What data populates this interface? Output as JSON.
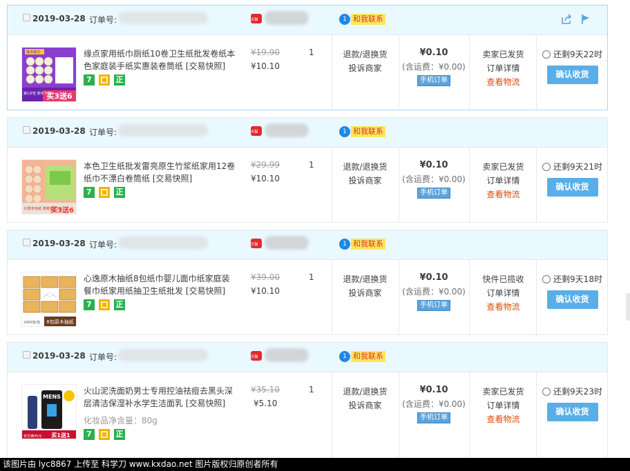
{
  "orders": [
    {
      "date": "2019-03-28",
      "order_label": "订单号:",
      "contact_label": "和我联系",
      "product": "缘点家用纸巾厕纸10卷卫生纸批发卷纸本色家庭装手纸实惠装卷筒纸 [交易快照]",
      "thumb_text_top": "缘点纸巾",
      "thumb_text_bottom": "买3送6",
      "thumb_side": "第1次性 随手下单",
      "price_old": "¥19.90",
      "price_new": "¥10.10",
      "qty": "1",
      "svc1": "退款/退换货",
      "svc2": "投诉商家",
      "total": "¥0.10",
      "shipping": "(含运费：¥0.00)",
      "mobile": "手机订单",
      "status": "卖家已发货",
      "detail": "订单详情",
      "logistics": "查看物流",
      "remain": "还剩9天22时",
      "confirm": "确认收货"
    },
    {
      "date": "2019-03-28",
      "order_label": "订单号:",
      "contact_label": "和我联系",
      "product": "本色卫生纸批发雷亮原生竹浆纸家用12卷纸巾不漂白卷筒纸 [交易快照]",
      "thumb_text_bottom": "买3送6",
      "thumb_side": "12卷本色纸 春卷低至7元",
      "price_old": "¥29.99",
      "price_new": "¥10.10",
      "qty": "1",
      "svc1": "退款/退换货",
      "svc2": "投诉商家",
      "total": "¥0.10",
      "shipping": "(含运费：¥0.00)",
      "mobile": "手机订单",
      "status": "卖家已发货",
      "detail": "订单详情",
      "logistics": "查看物流",
      "remain": "还剩9天21时",
      "confirm": "确认收货"
    },
    {
      "date": "2019-03-28",
      "order_label": "订单号:",
      "contact_label": "和我联系",
      "product": "心逸原木抽纸8包纸巾婴儿面巾纸家庭装餐巾纸家用纸抽卫生纸批发 [交易快照]",
      "thumb_text_bottom": "8包原木抽纸",
      "thumb_side": "2400张/包",
      "price_old": "¥39.00",
      "price_new": "¥10.10",
      "qty": "1",
      "svc1": "退款/退换货",
      "svc2": "投诉商家",
      "total": "¥0.10",
      "shipping": "(含运费：¥0.00)",
      "mobile": "手机订单",
      "status": "快件已揽收",
      "detail": "订单详情",
      "logistics": "查看物流",
      "remain": "还剩9天18时",
      "confirm": "确认收货"
    },
    {
      "date": "2019-03-28",
      "order_label": "订单号:",
      "contact_label": "和我联系",
      "product": "火山泥洗面奶男士专用控油祛痘去黑头深层清洁保湿补水学生洁面乳 [交易快照]",
      "extra": "化妆品净含量：80g",
      "thumb_text_top": "MENS",
      "thumb_text_bottom": "买1送1",
      "thumb_side": "实付满35元",
      "price_old": "¥35.10",
      "price_new": "¥5.10",
      "qty": "1",
      "svc1": "退款/退换货",
      "svc2": "投诉商家",
      "total": "¥0.10",
      "shipping": "(含运费：¥0.00)",
      "mobile": "手机订单",
      "status": "卖家已发货",
      "detail": "订单详情",
      "logistics": "查看物流",
      "remain": "还剩9天23时",
      "confirm": "确认收货"
    }
  ],
  "badges": {
    "seven": "7",
    "gold": "",
    "zheng": "正"
  },
  "footer": "该图片由 lyc8867 上传至 科学刀 www.kxdao.net 图片版权归原创者所有",
  "icons": {
    "share": "share-icon",
    "flag": "flag-icon",
    "contact": "wangwang-icon",
    "clock": "clock-icon"
  }
}
